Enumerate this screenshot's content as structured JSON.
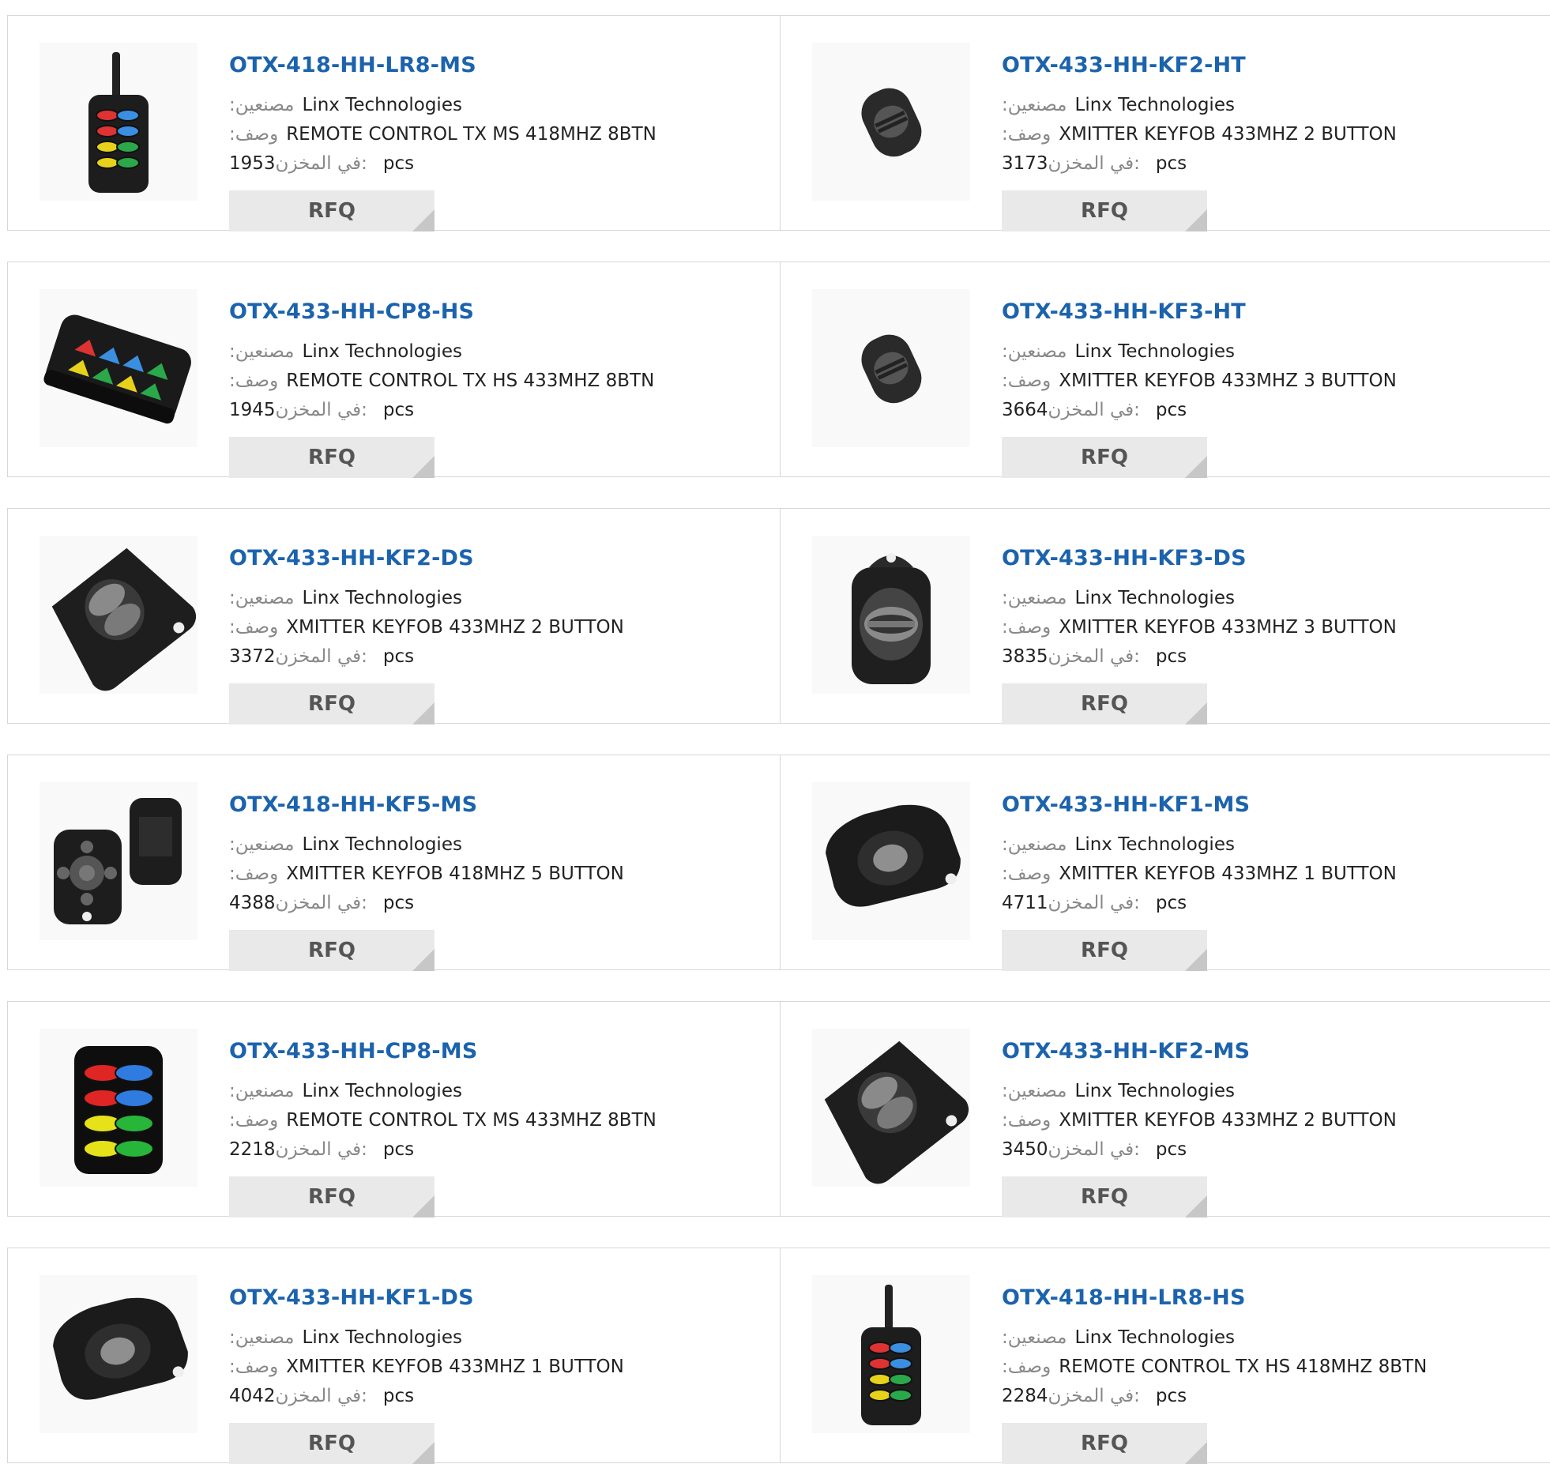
{
  "labels": {
    "manufacturer": ":مصنعين",
    "description": ":وصف",
    "stock": "في المخزن:",
    "unit": "pcs",
    "rfq": "RFQ"
  },
  "colors": {
    "link": "#1c63ad",
    "button_bg": "#e9e9e9",
    "border": "#d7d7d7"
  },
  "products": [
    {
      "part": "OTX-418-HH-LR8-MS",
      "manufacturer": "Linx Technologies",
      "description": "REMOTE CONTROL TX MS 418MHZ 8BTN",
      "stock": "1953",
      "image_icon": "remote-8btn-antenna-icon"
    },
    {
      "part": "OTX-433-HH-KF2-HT",
      "manufacturer": "Linx Technologies",
      "description": "XMITTER KEYFOB 433MHZ 2 BUTTON",
      "stock": "3173",
      "image_icon": "keyfob-small-icon"
    },
    {
      "part": "OTX-433-HH-CP8-HS",
      "manufacturer": "Linx Technologies",
      "description": "REMOTE CONTROL TX HS 433MHZ 8BTN",
      "stock": "1945",
      "image_icon": "remote-8btn-flat-icon"
    },
    {
      "part": "OTX-433-HH-KF3-HT",
      "manufacturer": "Linx Technologies",
      "description": "XMITTER KEYFOB 433MHZ 3 BUTTON",
      "stock": "3664",
      "image_icon": "keyfob-small-icon"
    },
    {
      "part": "OTX-433-HH-KF2-DS",
      "manufacturer": "Linx Technologies",
      "description": "XMITTER KEYFOB 433MHZ 2 BUTTON",
      "stock": "3372",
      "image_icon": "keyfob-2btn-icon"
    },
    {
      "part": "OTX-433-HH-KF3-DS",
      "manufacturer": "Linx Technologies",
      "description": "XMITTER KEYFOB 433MHZ 3 BUTTON",
      "stock": "3835",
      "image_icon": "keyfob-3btn-icon"
    },
    {
      "part": "OTX-418-HH-KF5-MS",
      "manufacturer": "Linx Technologies",
      "description": "XMITTER KEYFOB 418MHZ 5 BUTTON",
      "stock": "4388",
      "image_icon": "keyfob-5btn-icon"
    },
    {
      "part": "OTX-433-HH-KF1-MS",
      "manufacturer": "Linx Technologies",
      "description": "XMITTER KEYFOB 433MHZ 1 BUTTON",
      "stock": "4711",
      "image_icon": "keyfob-1btn-icon"
    },
    {
      "part": "OTX-433-HH-CP8-MS",
      "manufacturer": "Linx Technologies",
      "description": "REMOTE CONTROL TX MS 433MHZ 8BTN",
      "stock": "2218",
      "image_icon": "remote-8btn-numbered-icon"
    },
    {
      "part": "OTX-433-HH-KF2-MS",
      "manufacturer": "Linx Technologies",
      "description": "XMITTER KEYFOB 433MHZ 2 BUTTON",
      "stock": "3450",
      "image_icon": "keyfob-2btn-icon"
    },
    {
      "part": "OTX-433-HH-KF1-DS",
      "manufacturer": "Linx Technologies",
      "description": "XMITTER KEYFOB 433MHZ 1 BUTTON",
      "stock": "4042",
      "image_icon": "keyfob-1btn-icon"
    },
    {
      "part": "OTX-418-HH-LR8-HS",
      "manufacturer": "Linx Technologies",
      "description": "REMOTE CONTROL TX HS 418MHZ 8BTN",
      "stock": "2284",
      "image_icon": "remote-8btn-antenna-icon"
    }
  ]
}
